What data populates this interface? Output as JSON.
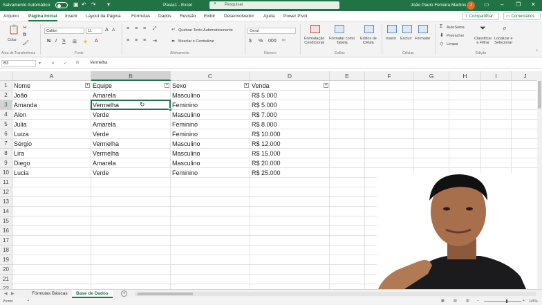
{
  "titlebar": {
    "autosave": "Salvamento Automático",
    "autosave_state": "Desligado",
    "title": "Pasta1 - Excel",
    "search_placeholder": "Pesquisar",
    "user": "João Paulo Ferreira Martins",
    "avatar_initial": "J"
  },
  "menu": {
    "tabs": [
      "Arquivo",
      "Página Inicial",
      "Inserir",
      "Layout da Página",
      "Fórmulas",
      "Dados",
      "Revisão",
      "Exibir",
      "Desenvolvedor",
      "Ajuda",
      "Power Pivot"
    ],
    "share": "Compartilhar",
    "comments": "Comentários"
  },
  "ribbon": {
    "paste": "Colar",
    "clipboard_label": "Área de Transferência",
    "font_name": "Calibri",
    "font_size": "11",
    "font_label": "Fonte",
    "wrap_text": "Quebrar Texto Automaticamente",
    "merge_center": "Mesclar e Centralizar",
    "alignment_label": "Alinhamento",
    "number_format": "Geral",
    "number_label": "Número",
    "cond_format": [
      "Formatação",
      "Condicional"
    ],
    "format_table": [
      "Formatar como",
      "Tabela"
    ],
    "cell_styles": [
      "Estilos de",
      "Célula"
    ],
    "styles_label": "Estilos",
    "insert": "Inserir",
    "delete": "Excluir",
    "format": "Formatar",
    "cells_label": "Células",
    "autosum": "AutoSoma",
    "fill": "Preencher",
    "clear": "Limpar",
    "sort_filter": [
      "Classificar",
      "e Filtrar"
    ],
    "find_select": [
      "Localizar e",
      "Selecionar"
    ],
    "editing_label": "Edição"
  },
  "formula_bar": {
    "name_box": "B3",
    "content": "Vermelha"
  },
  "grid": {
    "columns": [
      "A",
      "B",
      "C",
      "D",
      "E",
      "F",
      "G",
      "H",
      "I",
      "J"
    ],
    "rows": [
      "1",
      "2",
      "3",
      "4",
      "5",
      "6",
      "7",
      "8",
      "9",
      "10",
      "11",
      "12",
      "13",
      "14",
      "15",
      "16",
      "17",
      "18",
      "19",
      "20",
      "21",
      "22"
    ],
    "headers": [
      "Nome",
      "Equipe",
      "Sexo",
      "Venda"
    ],
    "data": [
      [
        "João",
        "Amarela",
        "Masculino",
        "R$ 5.000"
      ],
      [
        "Amanda",
        "Vermelha",
        "Feminino",
        "R$ 5.000"
      ],
      [
        "Alon",
        "Verde",
        "Masculino",
        "R$ 7.000"
      ],
      [
        "Julia",
        "Amarela",
        "Feminino",
        "R$ 8.000"
      ],
      [
        "Luiza",
        "Verde",
        "Feminino",
        "R$ 10.000"
      ],
      [
        "Sérgio",
        "Vermelha",
        "Masculino",
        "R$ 12.000"
      ],
      [
        "Lira",
        "Vermelha",
        "Masculino",
        "R$ 15.000"
      ],
      [
        "Diego",
        "Amarela",
        "Masculino",
        "R$ 20.000"
      ],
      [
        "Lucia",
        "Verde",
        "Feminino",
        "R$ 25.000"
      ]
    ]
  },
  "sheets": {
    "tabs": [
      "Fórmulas Básicas",
      "Base de Dados"
    ],
    "active": "Base de Dados"
  },
  "status": {
    "ready": "Pronto",
    "zoom": "145%"
  },
  "colors": {
    "excel_green": "#217346",
    "selection": "#217346"
  }
}
